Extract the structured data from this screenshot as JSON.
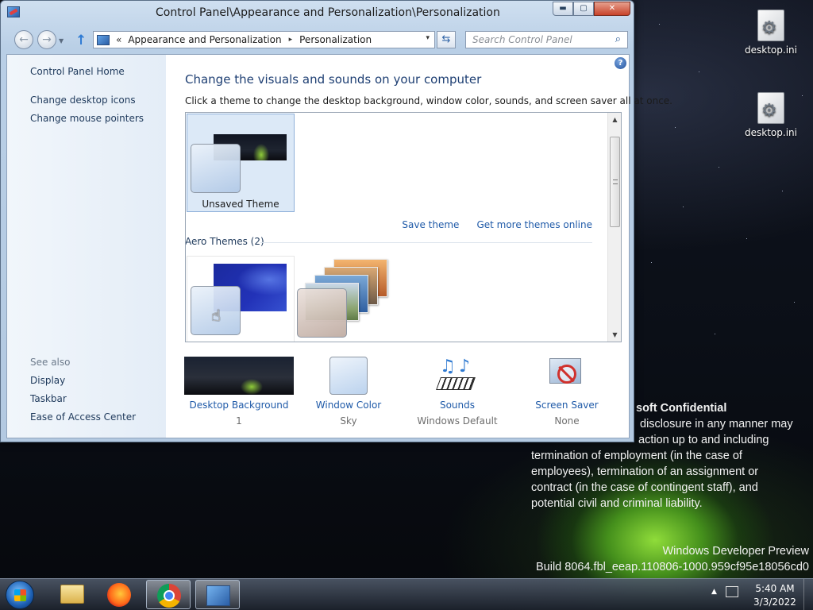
{
  "window": {
    "title": "Control Panel\\Appearance and Personalization\\Personalization",
    "caption_buttons": {
      "minimize": "▬",
      "maximize": "▢",
      "close": "✕"
    }
  },
  "address_bar": {
    "chevron": "«",
    "crumbs": [
      "Appearance and Personalization",
      "Personalization"
    ],
    "separator": "▸",
    "dropdown": "▾",
    "refresh_icon": "⇆"
  },
  "search": {
    "placeholder": "Search Control Panel",
    "icon": "⌕"
  },
  "sidebar": {
    "home": "Control Panel Home",
    "links": [
      "Change desktop icons",
      "Change mouse pointers"
    ],
    "see_also_label": "See also",
    "see_also": [
      "Display",
      "Taskbar",
      "Ease of Access Center"
    ]
  },
  "main": {
    "help_icon": "?",
    "heading": "Change the visuals and sounds on your computer",
    "subheading": "Click a theme to change the desktop background, window color, sounds, and screen saver all at once.",
    "my_theme": {
      "name": "Unsaved Theme"
    },
    "links": {
      "save_theme": "Save theme",
      "get_more": "Get more themes online"
    },
    "aero_group": "Aero Themes (2)"
  },
  "bottom": {
    "desktop_background": {
      "label": "Desktop Background",
      "value": "1"
    },
    "window_color": {
      "label": "Window Color",
      "value": "Sky"
    },
    "sounds": {
      "label": "Sounds",
      "value": "Windows Default"
    },
    "screen_saver": {
      "label": "Screen Saver",
      "value": "None"
    }
  },
  "desktop": {
    "icons": [
      {
        "label": "desktop.ini"
      },
      {
        "label": "desktop.ini"
      }
    ],
    "confidential": {
      "title": "soft Confidential",
      "lines": [
        "disclosure in any manner may",
        "action up to and including",
        "termination of employment (in the case of",
        "employees), termination of an assignment or",
        "contract (in the case of contingent staff), and",
        "potential civil and criminal liability."
      ]
    },
    "watermark": [
      "Windows Developer Preview",
      "Build 8064.fbl_eeap.110806-1000.959cf95e18056cd0"
    ]
  },
  "taskbar": {
    "apps": [
      "windows-explorer",
      "firefox",
      "chrome",
      "control-panel"
    ],
    "time": "5:40 AM",
    "date": "3/3/2022",
    "tray_arrow": "▲"
  }
}
